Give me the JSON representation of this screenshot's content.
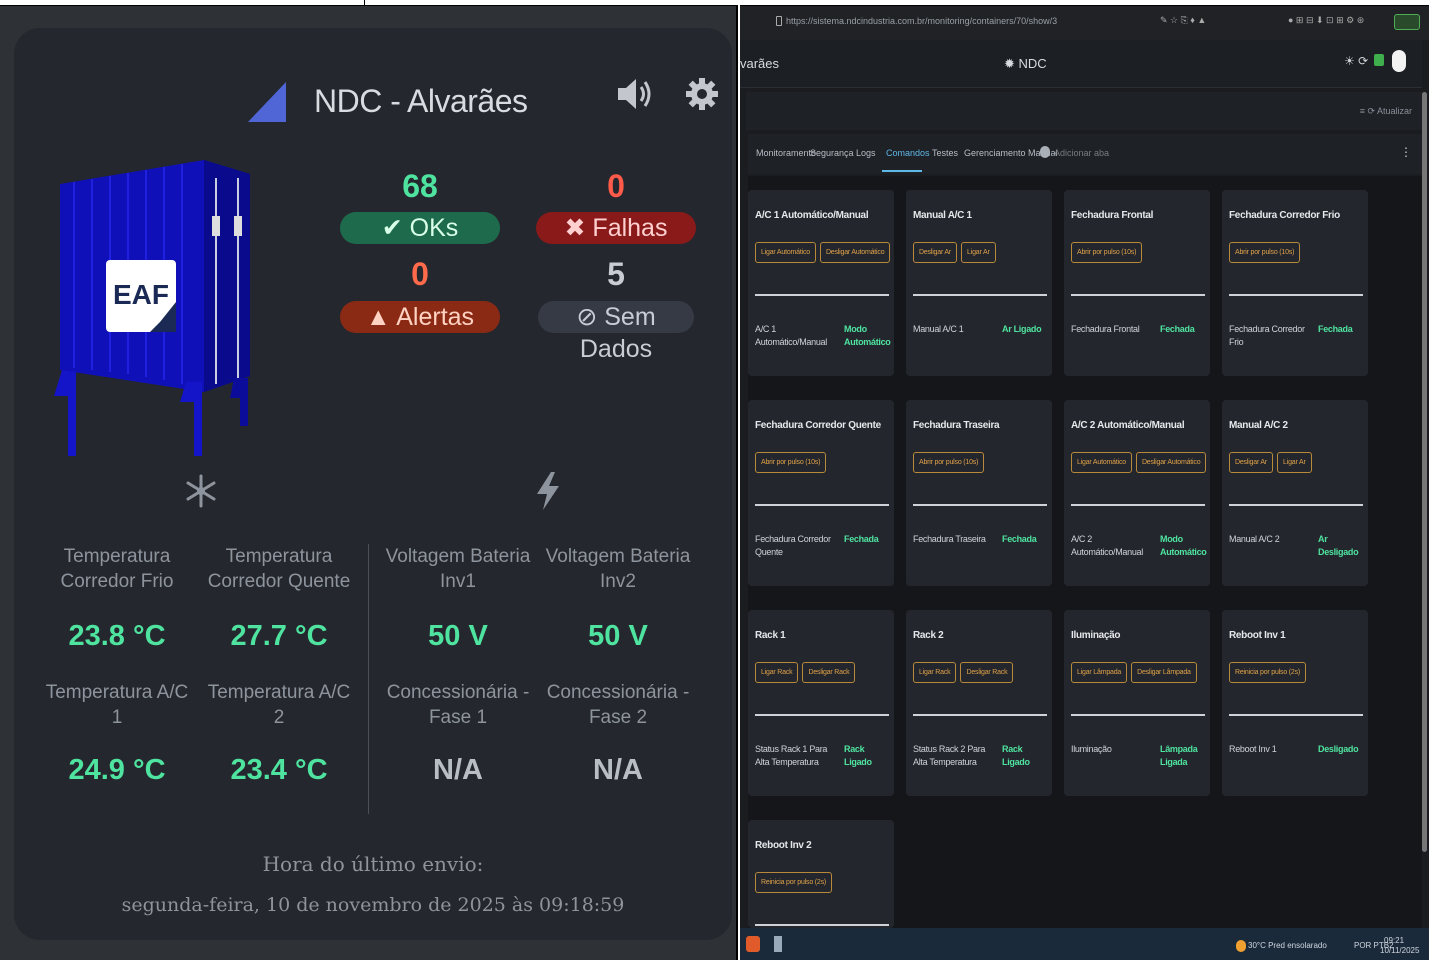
{
  "dashboard": {
    "title": "NDC - Alvarães",
    "container_logo_text": "EAF",
    "counts": {
      "ok": {
        "value": "68",
        "label": "OKs"
      },
      "fail": {
        "value": "0",
        "label": "Falhas"
      },
      "alert": {
        "value": "0",
        "label": "Alertas"
      },
      "nodata": {
        "value": "5",
        "label": "Sem Dados"
      }
    },
    "colors": {
      "ok": "#4fe3a0",
      "fail": "#ff4a4a",
      "alert": "#ff5a3a",
      "nodata": "#c8ccd4"
    },
    "metrics": [
      {
        "label": "Temperatura Corredor Frio",
        "value": "23.8 °C"
      },
      {
        "label": "Temperatura Corredor Quente",
        "value": "27.7 °C"
      },
      {
        "label": "Voltagem Bateria Inv1",
        "value": "50 V"
      },
      {
        "label": "Voltagem Bateria Inv2",
        "value": "50 V"
      },
      {
        "label": "Temperatura A/C 1",
        "value": "24.9 °C"
      },
      {
        "label": "Temperatura A/C 2",
        "value": "23.4 °C"
      },
      {
        "label": "Concessionária - Fase 1",
        "value": "N/A"
      },
      {
        "label": "Concessionária - Fase 2",
        "value": "N/A"
      }
    ],
    "last_send_label": "Hora do último envio:",
    "last_send_value": "segunda-feira, 10 de novembro de 2025 às 09:18:59"
  },
  "browser": {
    "url": "https://sistema.ndcindustria.com.br/monitoring/containers/70/show/3",
    "header_left": "varães",
    "header_center": "NDC",
    "subbar_right": "≡   ⟳ Atualizar",
    "tabs": [
      "Monitoramento",
      "Segurança",
      "Logs",
      "Comandos",
      "Testes",
      "Gerenciamento Manual",
      "Adicionar aba"
    ],
    "active_tab": "Comandos",
    "cards": [
      {
        "title": "A/C 1 Automático/Manual",
        "buttons": [
          "Ligar Automático",
          "Desligar Automático"
        ],
        "status_label": "A/C 1 Automático/Manual",
        "status_value": "Modo Automático"
      },
      {
        "title": "Manual A/C 1",
        "buttons": [
          "Desligar Ar",
          "Ligar Ar"
        ],
        "status_label": "Manual A/C 1",
        "status_value": "Ar Ligado"
      },
      {
        "title": "Fechadura Frontal",
        "buttons": [
          "Abrir por pulso (10s)"
        ],
        "status_label": "Fechadura Frontal",
        "status_value": "Fechada"
      },
      {
        "title": "Fechadura Corredor Frio",
        "buttons": [
          "Abrir por pulso (10s)"
        ],
        "status_label": "Fechadura Corredor Frio",
        "status_value": "Fechada"
      },
      {
        "title": "Fechadura Corredor Quente",
        "buttons": [
          "Abrir por pulso (10s)"
        ],
        "status_label": "Fechadura Corredor Quente",
        "status_value": "Fechada"
      },
      {
        "title": "Fechadura Traseira",
        "buttons": [
          "Abrir por pulso (10s)"
        ],
        "status_label": "Fechadura Traseira",
        "status_value": "Fechada"
      },
      {
        "title": "A/C 2 Automático/Manual",
        "buttons": [
          "Ligar Automático",
          "Desligar Automático"
        ],
        "status_label": "A/C 2 Automático/Manual",
        "status_value": "Modo Automático"
      },
      {
        "title": "Manual A/C 2",
        "buttons": [
          "Desligar Ar",
          "Ligar Ar"
        ],
        "status_label": "Manual A/C 2",
        "status_value": "Ar Desligado"
      },
      {
        "title": "Rack 1",
        "buttons": [
          "Ligar Rack",
          "Desligar Rack"
        ],
        "status_label": "Status Rack 1 Para Alta Temperatura",
        "status_value": "Rack Ligado"
      },
      {
        "title": "Rack 2",
        "buttons": [
          "Ligar Rack",
          "Desligar Rack"
        ],
        "status_label": "Status Rack 2 Para Alta Temperatura",
        "status_value": "Rack Ligado"
      },
      {
        "title": "Iluminação",
        "buttons": [
          "Ligar Lâmpada",
          "Desligar Lâmpada"
        ],
        "status_label": "Iluminação",
        "status_value": "Lâmpada Ligada"
      },
      {
        "title": "Reboot Inv 1",
        "buttons": [
          "Reinicia por pulso (2s)"
        ],
        "status_label": "Reboot Inv 1",
        "status_value": "Desligado"
      },
      {
        "title": "Reboot Inv 2",
        "buttons": [
          "Reinicia por pulso (2s)"
        ],
        "status_label": "",
        "status_value": ""
      }
    ],
    "taskbar": {
      "weather": "30°C  Pred ensolarado",
      "lang": "POR PTB2",
      "time": "09:21",
      "date": "10/11/2025"
    }
  }
}
